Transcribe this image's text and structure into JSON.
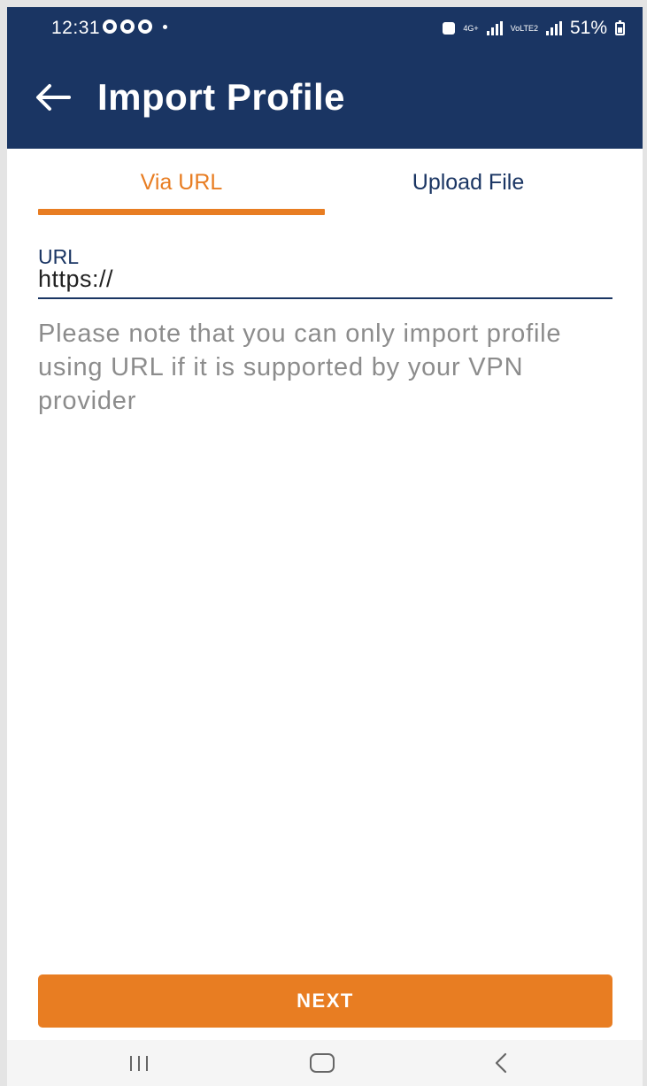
{
  "status_bar": {
    "time": "12:31",
    "network_label": "4G+",
    "volte_label": "VoLTE2",
    "battery": "51%"
  },
  "app_bar": {
    "title": "Import Profile",
    "background_color": "#1a3563"
  },
  "tabs": [
    {
      "label": "Via URL",
      "active": true
    },
    {
      "label": "Upload File",
      "active": false
    }
  ],
  "url_field": {
    "label": "URL",
    "value": "https://"
  },
  "note": "Please note that you can only import profile using URL if it is supported by your VPN provider",
  "next_button": {
    "label": "NEXT",
    "color": "#e87d22"
  },
  "nav_bar": {
    "buttons": [
      "recents-icon",
      "home-icon",
      "back-icon"
    ]
  }
}
